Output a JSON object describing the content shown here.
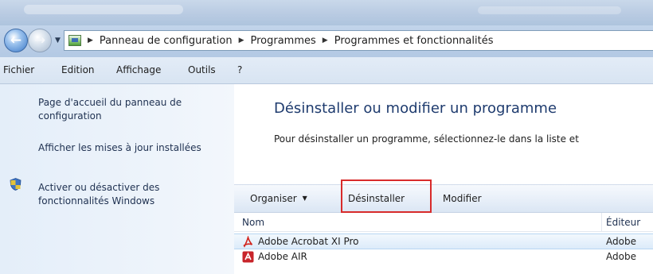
{
  "address": {
    "crumbs": [
      "Panneau de configuration",
      "Programmes",
      "Programmes et fonctionnalités"
    ]
  },
  "menu": {
    "items": [
      "Fichier",
      "Edition",
      "Affichage",
      "Outils",
      "?"
    ]
  },
  "sidebar": {
    "links": [
      "Page d'accueil du panneau de configuration",
      "Afficher les mises à jour installées",
      "Activer ou désactiver des fonctionnalités Windows"
    ]
  },
  "main": {
    "title": "Désinstaller ou modifier un programme",
    "description": "Pour désinstaller un programme, sélectionnez-le dans la liste et"
  },
  "toolbar": {
    "organize": "Organiser",
    "uninstall": "Désinstaller",
    "modify": "Modifier"
  },
  "list": {
    "columns": [
      "Nom",
      "Éditeur"
    ],
    "rows": [
      {
        "name": "Adobe Acrobat XI Pro",
        "publisher": "Adobe",
        "icon": "acrobat-icon"
      },
      {
        "name": "Adobe AIR",
        "publisher": "Adobe",
        "icon": "adobe-air-icon"
      }
    ]
  },
  "colors": {
    "highlight": "#d82b2b",
    "title": "#1e3b6e"
  }
}
